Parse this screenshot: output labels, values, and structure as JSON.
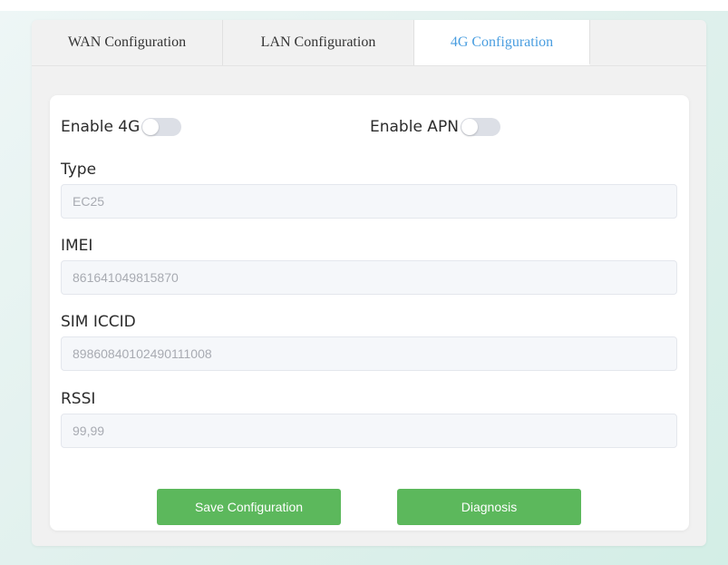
{
  "tabs": [
    {
      "label": "WAN Configuration",
      "active": false
    },
    {
      "label": "LAN Configuration",
      "active": false
    },
    {
      "label": "4G Configuration",
      "active": true
    }
  ],
  "toggles": {
    "enable_4g": {
      "label": "Enable 4G",
      "on": false
    },
    "enable_apn": {
      "label": "Enable APN",
      "on": false
    }
  },
  "fields": {
    "type": {
      "label": "Type",
      "placeholder": "EC25"
    },
    "imei": {
      "label": "IMEI",
      "placeholder": "861641049815870"
    },
    "sim_iccid": {
      "label": "SIM ICCID",
      "placeholder": "89860840102490111008"
    },
    "rssi": {
      "label": "RSSI",
      "placeholder": "99,99"
    }
  },
  "buttons": {
    "save": "Save Configuration",
    "diagnosis": "Diagnosis"
  },
  "colors": {
    "accent": "#4a9ee0",
    "button": "#5cb85c",
    "switch_off": "#dcdfe6"
  }
}
